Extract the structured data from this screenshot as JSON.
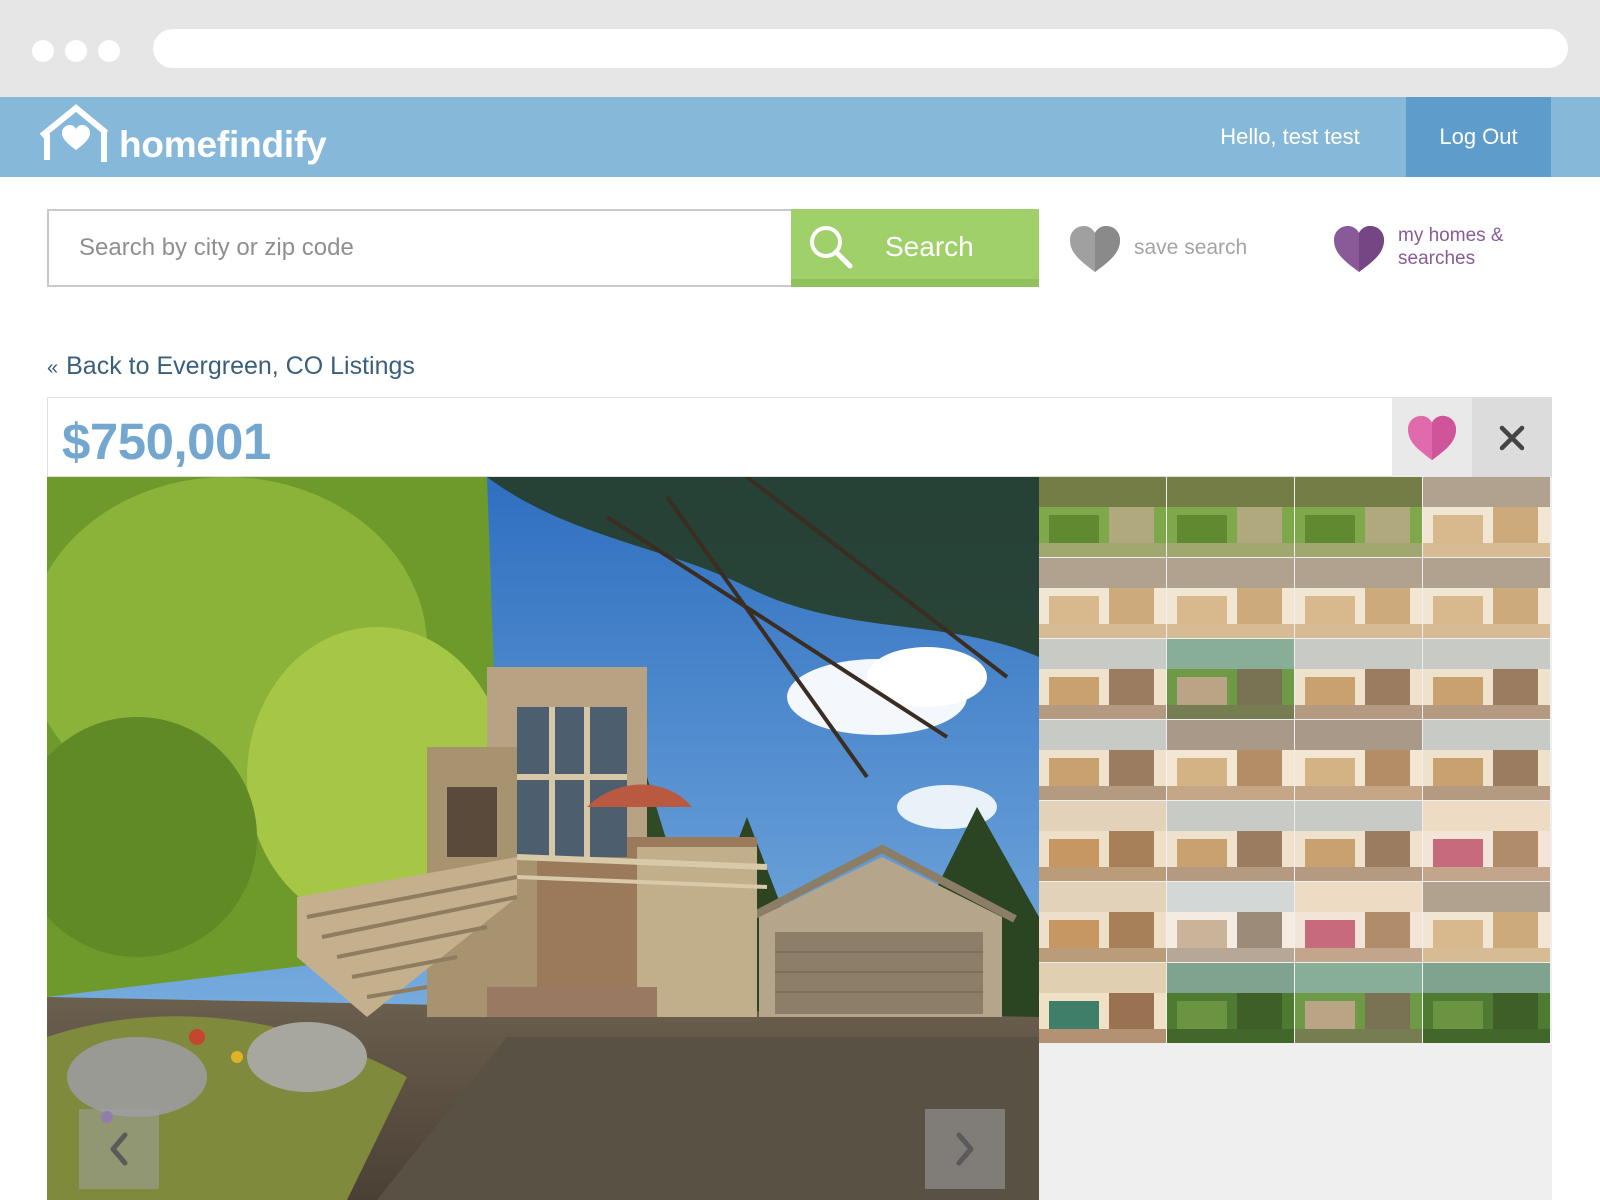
{
  "colors": {
    "header_bg": "#86b8d9",
    "logout_bg": "#5d9ccb",
    "search_button": "#9fd06a",
    "price": "#74a7cf",
    "favorite_heart": "#e06aab",
    "my_homes": "#8a5a98",
    "save_search_heart": "#a0a0a0"
  },
  "header": {
    "logo_text": "homefindify",
    "greeting": "Hello, test test",
    "logout_label": "Log Out"
  },
  "search": {
    "placeholder": "Search by city or zip code",
    "value": "",
    "button_label": "Search",
    "save_search_label": "save search",
    "my_homes_label": "my homes & searches"
  },
  "navigation": {
    "back_chevron": "«",
    "back_link_label": "Back to Evergreen, CO Listings"
  },
  "listing": {
    "price": "$750,001",
    "main_photo_icon": "house-exterior-photo",
    "thumbnails": [
      {
        "kind": "exterior"
      },
      {
        "kind": "exterior"
      },
      {
        "kind": "exterior"
      },
      {
        "kind": "kitchen"
      },
      {
        "kind": "kitchen"
      },
      {
        "kind": "kitchen"
      },
      {
        "kind": "kitchen"
      },
      {
        "kind": "kitchen"
      },
      {
        "kind": "living"
      },
      {
        "kind": "deck"
      },
      {
        "kind": "living"
      },
      {
        "kind": "living"
      },
      {
        "kind": "living"
      },
      {
        "kind": "dining"
      },
      {
        "kind": "dining"
      },
      {
        "kind": "living"
      },
      {
        "kind": "office"
      },
      {
        "kind": "living"
      },
      {
        "kind": "living"
      },
      {
        "kind": "bedroom"
      },
      {
        "kind": "office"
      },
      {
        "kind": "bathroom"
      },
      {
        "kind": "bedroom"
      },
      {
        "kind": "kitchen"
      },
      {
        "kind": "game-room"
      },
      {
        "kind": "forest"
      },
      {
        "kind": "deck"
      },
      {
        "kind": "forest"
      }
    ]
  }
}
